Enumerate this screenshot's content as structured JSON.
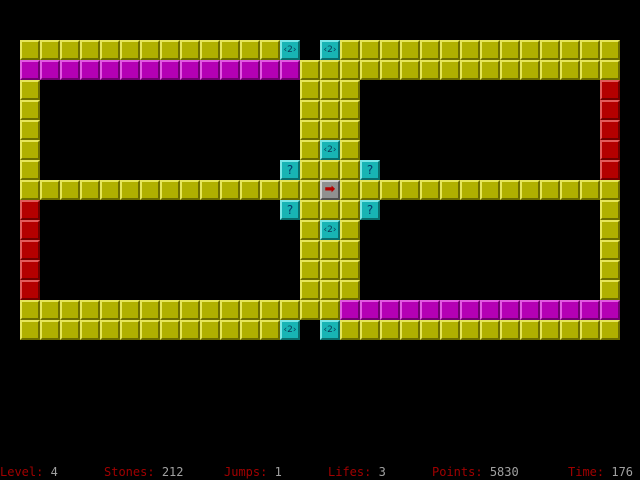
{
  "board": {
    "rows": [
      "yyyyyyyyyyyyyc.cyyyyyyyyyyyyyy",
      "mmmmmmmmmmmmmmyyyyyyyyyyyyyyyy",
      "y.............yyy............r",
      "y.............yyy............r",
      "y.............yyy............r",
      "y.............ycy............r",
      "y............cyyyc...........r",
      "yyyyyyyyyyyyyyyayyyyyyyyyyyyyy",
      "r............cyyyc...........y",
      "r.............ycy............y",
      "r.............yyy............y",
      "r.............yyy............y",
      "r.............yyy............y",
      "yyyyyyyyyyyyyyyymmmmmmmmmmmmmm",
      "yyyyyyyyyyyyyc.cyyyyyyyyyyyyyy"
    ],
    "tile_colors": {
      "y": "#b0b000",
      "m": "#b400b4",
      "r": "#b40000",
      "c": "#18b4b4",
      "a": "#909090"
    },
    "special_tiles": [
      {
        "row": 0,
        "col": 13,
        "kind": "double-arrow",
        "label": "2"
      },
      {
        "row": 0,
        "col": 15,
        "kind": "double-arrow",
        "label": "2"
      },
      {
        "row": 5,
        "col": 15,
        "kind": "double-arrow",
        "label": "2"
      },
      {
        "row": 6,
        "col": 13,
        "kind": "question",
        "label": "?"
      },
      {
        "row": 6,
        "col": 17,
        "kind": "question",
        "label": "?"
      },
      {
        "row": 7,
        "col": 15,
        "kind": "arrow-right",
        "label": "➡"
      },
      {
        "row": 8,
        "col": 13,
        "kind": "question",
        "label": "?"
      },
      {
        "row": 8,
        "col": 17,
        "kind": "question",
        "label": "?"
      },
      {
        "row": 9,
        "col": 15,
        "kind": "double-arrow",
        "label": "2"
      },
      {
        "row": 14,
        "col": 13,
        "kind": "double-arrow",
        "label": "2"
      },
      {
        "row": 14,
        "col": 15,
        "kind": "double-arrow",
        "label": "2"
      }
    ]
  },
  "status": {
    "level_label": "Level:",
    "level_value": "4",
    "stones_label": "Stones:",
    "stones_value": "212",
    "jumps_label": "Jumps:",
    "jumps_value": "1",
    "lifes_label": "Lifes:",
    "lifes_value": "3",
    "points_label": "Points:",
    "points_value": "5830",
    "time_label": "Time:",
    "time_value": "176"
  }
}
